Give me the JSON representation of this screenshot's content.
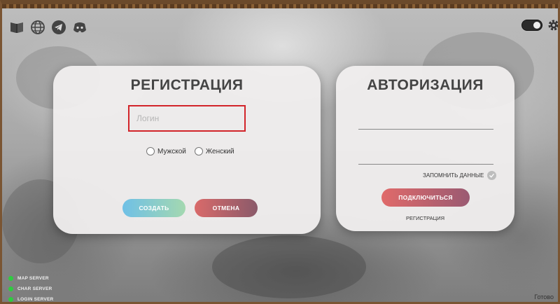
{
  "toolbar": {
    "icons": [
      "book-icon",
      "globe-icon",
      "telegram-icon",
      "discord-icon"
    ],
    "theme_toggle": "toggle-icon",
    "settings_icon": "gear-icon"
  },
  "registration": {
    "title": "РЕГИСТРАЦИЯ",
    "login_placeholder": "Логин",
    "gender_male": "Мужской",
    "gender_female": "Женский",
    "create_label": "СОЗДАТЬ",
    "cancel_label": "ОТМЕНА"
  },
  "authorization": {
    "title": "АВТОРИЗАЦИЯ",
    "remember_label": "ЗАПОМНИТЬ ДАННЫЕ",
    "connect_label": "ПОДКЛЮЧИТЬСЯ",
    "register_link": "РЕГИСТРАЦИЯ"
  },
  "servers": [
    {
      "label": "MAP SERVER",
      "status_color": "#2ecc40"
    },
    {
      "label": "CHAR SERVER",
      "status_color": "#2ecc40"
    },
    {
      "label": "LOGIN SERVER",
      "status_color": "#2ecc40"
    }
  ],
  "status": "Готово",
  "colors": {
    "invalid_border": "#d2242a",
    "create_gradient": [
      "#6fc0e6",
      "#a4d8b0"
    ],
    "cancel_gradient": [
      "#d96a6a",
      "#8a5a6a"
    ],
    "online": "#2ecc40"
  }
}
